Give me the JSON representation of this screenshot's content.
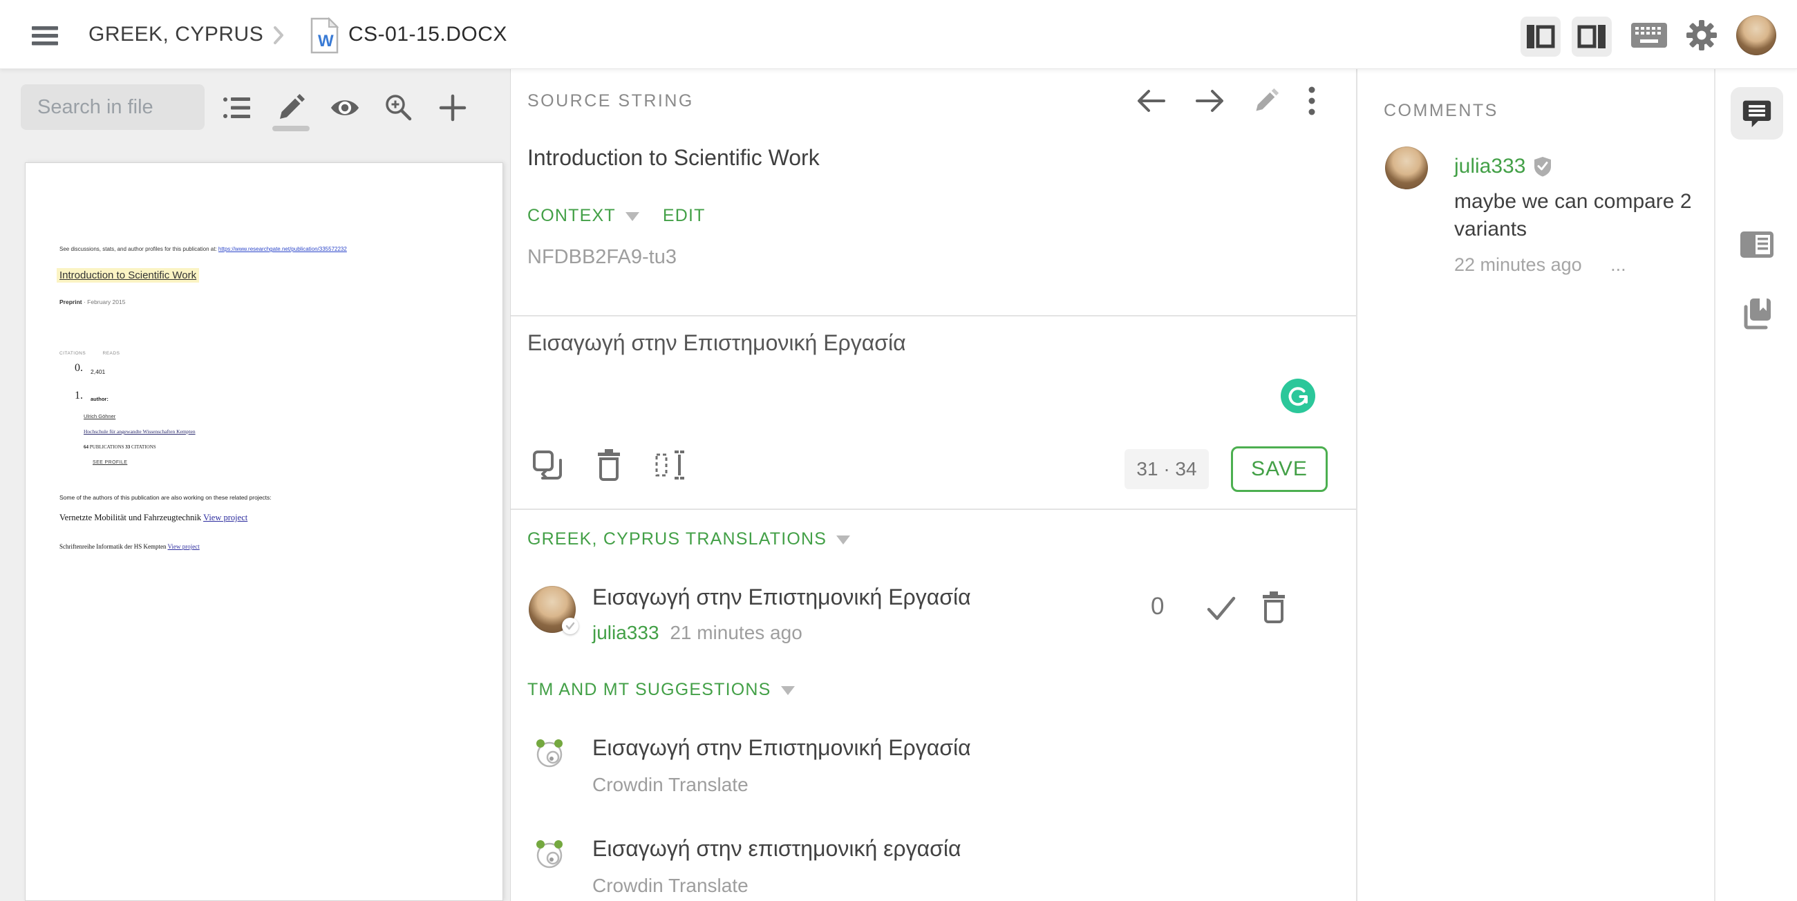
{
  "topbar": {
    "project": "GREEK, CYPRUS",
    "file": "CS-01-15.DOCX"
  },
  "left_panel": {
    "search_placeholder": "Search in file",
    "doc": {
      "intro": "See discussions, stats, and author profiles for this publication at:",
      "intro_link": "https://www.researchgate.net/publication/335572232",
      "title": "Introduction to Scientific Work",
      "type_label": "Preprint",
      "type_date": "· February 2015",
      "citations_label": "CITATIONS",
      "reads_label": "READS",
      "num0": "0.",
      "reads_value": "2,401",
      "num1": "1.",
      "author_label": "author:",
      "author_name": "Ulrich Göhner",
      "affiliation": "Hochschule für angewandte Wissenschaften Kempten",
      "pub_count": "64",
      "pub_label": "PUBLICATIONS",
      "cit_count": "33",
      "cit_label": "CITATIONS",
      "see_profile": "SEE PROFILE",
      "related": "Some of the authors of this publication are also working on these related projects:",
      "project1": "Vernetzte Mobilität und Fahrzeugtechnik",
      "project1_link": "View project",
      "project2": "Schriftenreihe Informatik der HS Kempten",
      "project2_link": "View project"
    }
  },
  "source": {
    "label": "SOURCE STRING",
    "text": "Introduction to Scientific Work",
    "context_label": "CONTEXT",
    "edit_label": "EDIT",
    "context_value": "NFDBB2FA9-tu3"
  },
  "editor": {
    "translation": "Εισαγωγή στην Επιστημονική Εργασία",
    "counter": "31 · 34",
    "save_label": "SAVE"
  },
  "translations": {
    "header": "GREEK, CYPRUS TRANSLATIONS",
    "items": [
      {
        "text": "Εισαγωγή στην Επιστημονική Εργασία",
        "author": "julia333",
        "time": "21 minutes ago",
        "votes": "0"
      }
    ]
  },
  "suggestions": {
    "header": "TM AND MT SUGGESTIONS",
    "items": [
      {
        "text": "Εισαγωγή στην Επιστημονική Εργασία",
        "provider": "Crowdin Translate"
      },
      {
        "text": "Εισαγωγή στην επιστημονική εργασία",
        "provider": "Crowdin Translate"
      }
    ]
  },
  "comments": {
    "header": "COMMENTS",
    "items": [
      {
        "author": "julia333",
        "text": "maybe we can compare 2 variants",
        "time": "22 minutes ago",
        "more": "..."
      }
    ]
  },
  "colors": {
    "green": "#43A047",
    "save_border": "#4CAF50",
    "grammarly_green": "#2BC79A",
    "title_highlight": "#FBF4C4"
  },
  "icons": {
    "menu-icon": "hamburger",
    "breadcrumb-chevron-icon": "›",
    "word-file-icon": "W",
    "panel-left-icon": "layout-left",
    "panel-right-icon": "layout-right",
    "keyboard-icon": "keyboard",
    "gear-icon": "settings",
    "list-icon": "strings-list",
    "pencil-icon": "edit",
    "eye-icon": "preview",
    "zoom-in-icon": "magnifier-plus",
    "plus-icon": "+",
    "arrow-left-icon": "←",
    "arrow-right-icon": "→",
    "kebab-icon": "⋮",
    "caret-down-icon": "▼",
    "copy-source-icon": "copy",
    "trash-icon": "delete",
    "select-text-icon": "select",
    "grammarly-icon": "G",
    "check-icon": "✓",
    "shield-check-icon": "verified",
    "panda-icon": "crowdin-mascot",
    "comment-icon": "comments",
    "card-icon": "info-card",
    "books-icon": "glossary"
  }
}
